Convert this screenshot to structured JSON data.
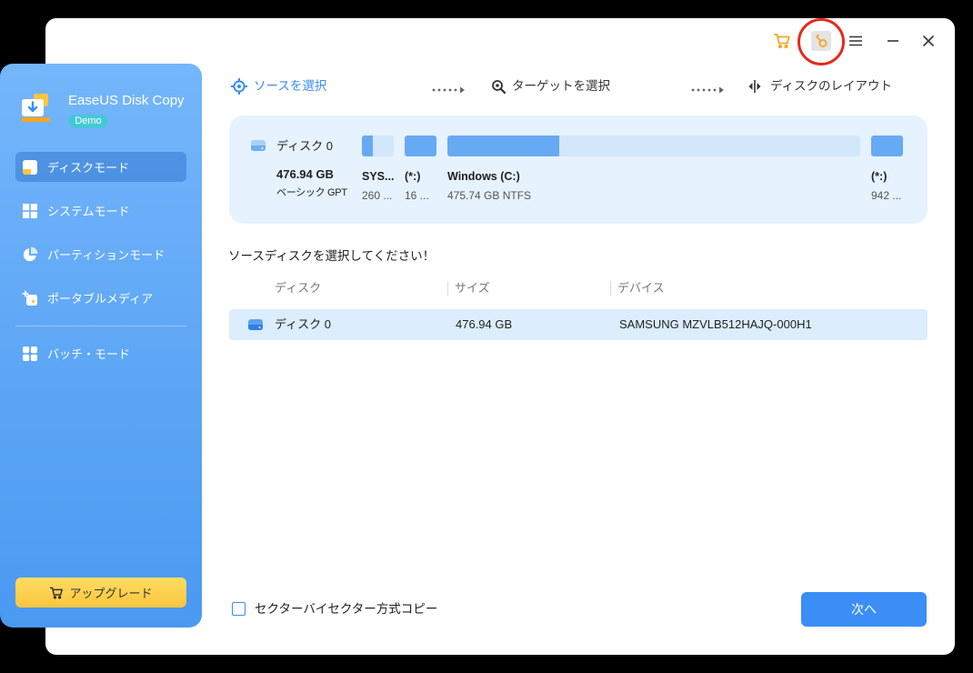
{
  "app": {
    "name": "EaseUS Disk Copy",
    "badge": "Demo"
  },
  "titlebar": {
    "icons": [
      "cart-icon",
      "key-icon",
      "menu-icon",
      "minimize-icon",
      "close-icon"
    ]
  },
  "sidebar": {
    "items": [
      {
        "label": "ディスクモード",
        "icon": "disk-mode-icon",
        "selected": true
      },
      {
        "label": "システムモード",
        "icon": "windows-icon",
        "selected": false
      },
      {
        "label": "パーティションモード",
        "icon": "pie-chart-icon",
        "selected": false
      },
      {
        "label": "ポータブルメディア",
        "icon": "portable-media-icon",
        "selected": false
      },
      {
        "label": "バッチ・モード",
        "icon": "grid-icon",
        "selected": false
      }
    ],
    "upgrade": {
      "label": "アップグレード",
      "icon": "cart-icon"
    }
  },
  "steps": [
    {
      "label": "ソースを選択",
      "icon": "crosshair-icon",
      "active": true
    },
    {
      "label": "ターゲットを選択",
      "icon": "target-search-icon",
      "active": false
    },
    {
      "label": "ディスクのレイアウト",
      "icon": "layout-icon",
      "active": false
    }
  ],
  "disk_card": {
    "icon": "disk-icon",
    "name": "ディスク 0",
    "size": "476.94 GB",
    "type": "ベーシック GPT",
    "partitions": [
      {
        "name": "SYS...",
        "size": "260 ...",
        "used_fraction": 0.34
      },
      {
        "name": "(*:)",
        "size": "16 ...",
        "used_fraction": 1.0
      },
      {
        "name": "Windows (C:)",
        "size": "475.74 GB NTFS",
        "used_fraction": 0.27
      },
      {
        "name": "(*:)",
        "size": "942 ...",
        "used_fraction": 1.0
      }
    ]
  },
  "source_prompt": "ソースディスクを選択してください！",
  "disk_table": {
    "headers": [
      "ディスク",
      "サイズ",
      "デバイス"
    ],
    "rows": [
      {
        "disk": "ディスク 0",
        "size": "476.94 GB",
        "device": "SAMSUNG MZVLB512HAJQ-000H1",
        "selected": true
      }
    ]
  },
  "sector_copy": {
    "label": "セクターバイセクター方式コピー",
    "checked": false
  },
  "next_button": {
    "label": "次へ"
  },
  "colors": {
    "accent": "#3a8ef6",
    "cart": "#f5a623",
    "highlight": "#e8291c",
    "upgrade": "#fcc53d",
    "badge": "#45c8d6",
    "sidebar_top": "#74b6fb",
    "sidebar_bottom": "#4a99f1"
  }
}
